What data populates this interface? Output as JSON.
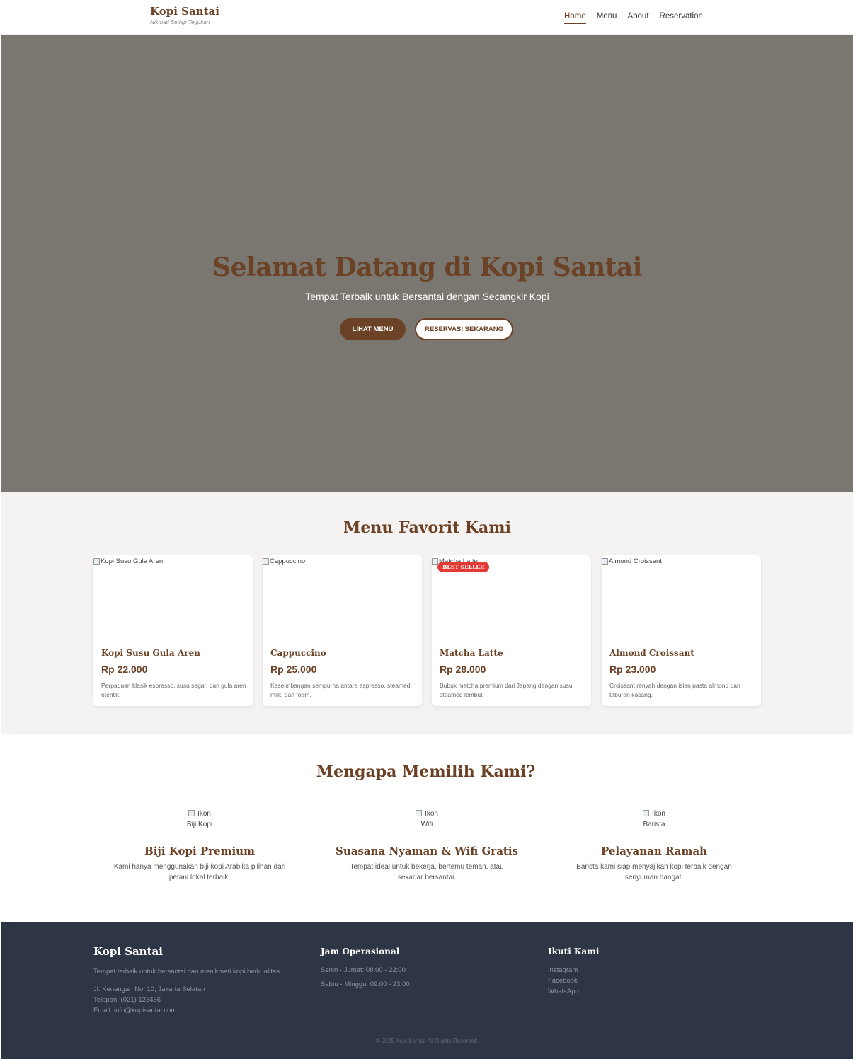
{
  "header": {
    "brand": "Kopi Santai",
    "tagline": "Nikmati Setiap Tegukan",
    "nav": [
      "Home",
      "Menu",
      "About",
      "Reservation"
    ]
  },
  "hero": {
    "title": "Selamat Datang di Kopi Santai",
    "subtitle": "Tempat Terbaik untuk Bersantai dengan Secangkir Kopi",
    "primary_button": "Lihat Menu",
    "secondary_button": "Reservasi Sekarang"
  },
  "favorites": {
    "title": "Menu Favorit Kami",
    "items": [
      {
        "alt": "Kopi Susu Gula Aren",
        "name": "Kopi Susu Gula Aren",
        "price": "Rp 22.000",
        "desc": "Perpaduan klasik espresso, susu segar, dan gula aren otentik.",
        "badge": ""
      },
      {
        "alt": "Cappuccino",
        "name": "Cappuccino",
        "price": "Rp 25.000",
        "desc": "Keseimbangan sempurna antara espresso, steamed milk, dan foam.",
        "badge": ""
      },
      {
        "alt": "Matcha Latte",
        "name": "Matcha Latte",
        "price": "Rp 28.000",
        "desc": "Bubuk matcha premium dari Jepang dengan susu steamed lembut.",
        "badge": "BEST SELLER"
      },
      {
        "alt": "Almond Croissant",
        "name": "Almond Croissant",
        "price": "Rp 23.000",
        "desc": "Croissant renyah dengan isian pasta almond dan taburan kacang.",
        "badge": ""
      }
    ]
  },
  "why": {
    "title": "Mengapa Memilih Kami?",
    "features": [
      {
        "icon_alt_1": "Ikon",
        "icon_alt_2": "Biji Kopi",
        "name": "Biji Kopi Premium",
        "desc": "Kami hanya menggunakan biji kopi Arabika pilihan dari petani lokal terbaik."
      },
      {
        "icon_alt_1": "Ikon",
        "icon_alt_2": "Wifi",
        "name": "Suasana Nyaman & Wifi Gratis",
        "desc": "Tempat ideal untuk bekerja, bertemu teman, atau sekadar bersantai."
      },
      {
        "icon_alt_1": "Ikon",
        "icon_alt_2": "Barista",
        "name": "Pelayanan Ramah",
        "desc": "Barista kami siap menyajikan kopi terbaik dengan senyuman hangat."
      }
    ]
  },
  "footer": {
    "brand": "Kopi Santai",
    "about": "Tempat terbaik untuk bersantai dan menikmati kopi berkualitas.",
    "address": "Jl. Kenangan No. 10, Jakarta Selatan",
    "phone": "Telepon: (021) 123456",
    "email": "Email: info@kopisantai.com",
    "hours_title": "Jam Operasional",
    "hours": [
      "Senin - Jumat: 08:00 - 22:00",
      "Sabtu - Minggu: 09:00 - 23:00"
    ],
    "social_title": "Ikuti Kami",
    "social": [
      "Instagram",
      "Facebook",
      "WhatsApp"
    ],
    "copyright": "© 2025 Kopi Santai. All Rights Reserved."
  }
}
